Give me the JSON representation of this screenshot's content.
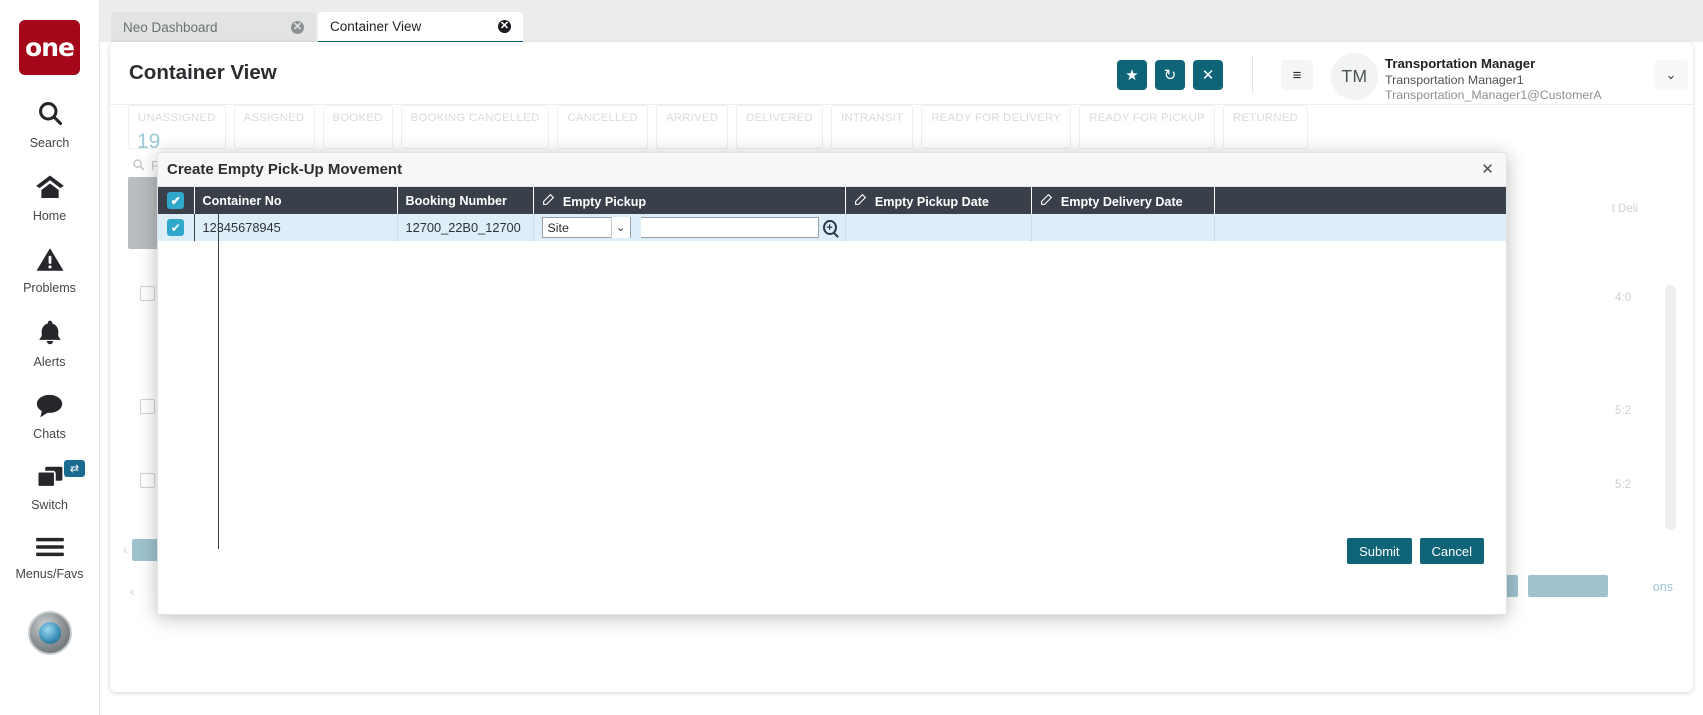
{
  "rail": {
    "logo_text": "one",
    "items": [
      {
        "label": "Search",
        "icon": "search-icon"
      },
      {
        "label": "Home",
        "icon": "home-icon"
      },
      {
        "label": "Problems",
        "icon": "warning-triangle-icon"
      },
      {
        "label": "Alerts",
        "icon": "bell-icon"
      },
      {
        "label": "Chats",
        "icon": "chat-bubble-icon"
      },
      {
        "label": "Switch",
        "icon": "windows-stack-icon",
        "badge": "⇄"
      },
      {
        "label": "Menus/Favs",
        "icon": "hamburger-icon"
      }
    ]
  },
  "tabs": [
    {
      "label": "Neo Dashboard",
      "active": false,
      "close": "✕"
    },
    {
      "label": "Container View",
      "active": true,
      "close": "✕"
    }
  ],
  "header": {
    "title": "Container View",
    "actions": [
      {
        "name": "favorite-button",
        "glyph": "★"
      },
      {
        "name": "refresh-button",
        "glyph": "↻"
      },
      {
        "name": "close-button",
        "glyph": "✕"
      }
    ],
    "menu_glyph": "≡",
    "caret_glyph": "⌄",
    "user": {
      "initials": "TM",
      "role": "Transportation Manager",
      "name": "Transportation Manager1",
      "email": "Transportation_Manager1@CustomerA"
    }
  },
  "background": {
    "status_tabs": [
      "UNASSIGNED",
      "ASSIGNED",
      "BOOKED",
      "BOOKING CANCELLED",
      "CANCELLED",
      "ARRIVED",
      "DELIVERED",
      "INTRANSIT",
      "READY FOR DELIVERY",
      "READY FOR PICKUP",
      "RETURNED"
    ],
    "count": "19",
    "filter_label": "Filters",
    "filter_icon": "search-icon",
    "column_hint": "t Deli",
    "time_cells": [
      "4:0",
      "5:2",
      "5:2"
    ],
    "actions_label": "ons"
  },
  "modal": {
    "title": "Create Empty Pick-Up Movement",
    "close_glyph": "✕",
    "select_all_glyph": "✔",
    "columns": [
      {
        "label": "Container No",
        "editable": false
      },
      {
        "label": "Booking Number",
        "editable": false
      },
      {
        "label": "Empty Pickup",
        "editable": true
      },
      {
        "label": "Empty Pickup Date",
        "editable": true
      },
      {
        "label": "Empty Delivery Date",
        "editable": true
      }
    ],
    "edit_icon_glyph": "✎",
    "rows": [
      {
        "checked": true,
        "check_glyph": "✔",
        "container_no": "12345678945",
        "booking_number": "12700_22B0_12700",
        "empty_pickup_type": "Site",
        "empty_pickup_value": "",
        "empty_pickup_placeholder": "",
        "lookup_icon": "magnifier-plus-icon",
        "empty_pickup_date": "",
        "empty_delivery_date": ""
      }
    ],
    "buttons": {
      "submit_label": "Submit",
      "cancel_label": "Cancel"
    }
  },
  "colors": {
    "brand_red": "#a4061a",
    "teal": "#0f6478",
    "header_dark": "#3a4049",
    "row_blue": "#ddeef8",
    "check_blue": "#2fa8cc",
    "link_blue": "#2d6fa8"
  }
}
